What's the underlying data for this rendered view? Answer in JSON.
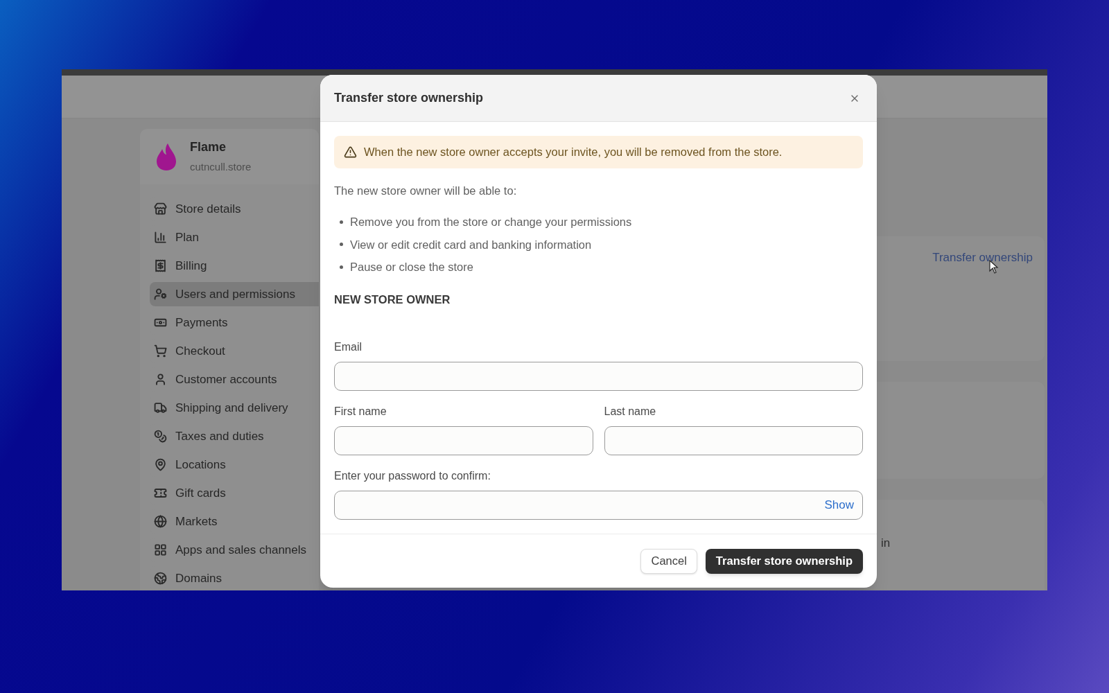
{
  "sidebar": {
    "store": {
      "name": "Flame",
      "domain": "cutncull.store"
    },
    "items": [
      {
        "label": "Store details",
        "selected": false
      },
      {
        "label": "Plan",
        "selected": false
      },
      {
        "label": "Billing",
        "selected": false
      },
      {
        "label": "Users and permissions",
        "selected": true
      },
      {
        "label": "Payments",
        "selected": false
      },
      {
        "label": "Checkout",
        "selected": false
      },
      {
        "label": "Customer accounts",
        "selected": false
      },
      {
        "label": "Shipping and delivery",
        "selected": false
      },
      {
        "label": "Taxes and duties",
        "selected": false
      },
      {
        "label": "Locations",
        "selected": false
      },
      {
        "label": "Gift cards",
        "selected": false
      },
      {
        "label": "Markets",
        "selected": false
      },
      {
        "label": "Apps and sales channels",
        "selected": false
      },
      {
        "label": "Domains",
        "selected": false
      }
    ]
  },
  "background": {
    "link": "Transfer ownership",
    "fragment": "in"
  },
  "dialog": {
    "title": "Transfer store ownership",
    "warning": "When the new store owner accepts your invite, you will be removed from the store.",
    "intro": "The new store owner will be able to:",
    "abilities": [
      "Remove you from the store or change your permissions",
      "View or edit credit card and banking information",
      "Pause or close the store"
    ],
    "section": "NEW STORE OWNER",
    "fields": {
      "email": "Email",
      "first_name": "First name",
      "last_name": "Last name",
      "password": "Enter your password to confirm:",
      "show": "Show"
    },
    "buttons": {
      "cancel": "Cancel",
      "confirm": "Transfer store ownership"
    }
  }
}
